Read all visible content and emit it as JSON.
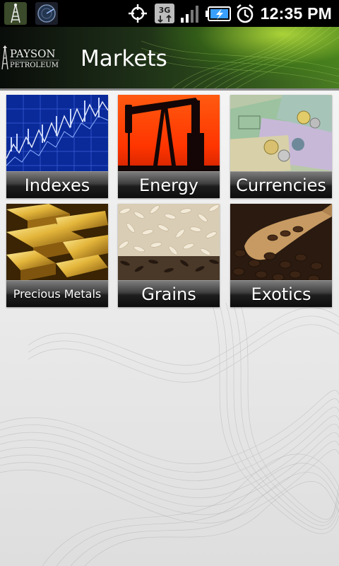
{
  "status_bar": {
    "time": "12:35 PM",
    "left_icons": [
      "tower-icon",
      "radar-icon"
    ],
    "right_icons": [
      "gps-icon",
      "3g-icon",
      "signal-icon",
      "battery-charging-icon",
      "alarm-icon"
    ],
    "network_label": "3G"
  },
  "header": {
    "title": "Markets",
    "logo_text_line1": "PAYSON",
    "logo_text_line2": "PETROLEUM"
  },
  "markets": {
    "items": [
      {
        "label": "Indexes"
      },
      {
        "label": "Energy"
      },
      {
        "label": "Currencies"
      },
      {
        "label": "Precious Metals"
      },
      {
        "label": "Grains"
      },
      {
        "label": "Exotics"
      }
    ]
  }
}
